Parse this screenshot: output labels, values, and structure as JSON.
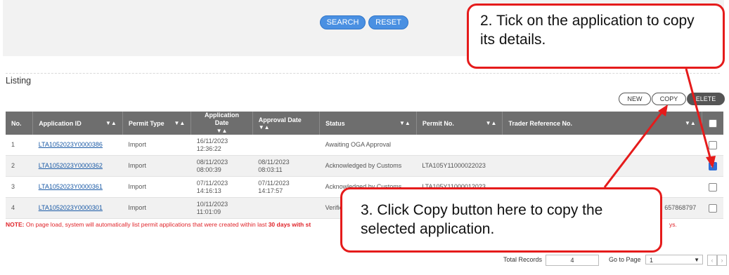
{
  "search_bar": {
    "search_label": "SEARCH",
    "reset_label": "RESET"
  },
  "listing": {
    "title": "Listing",
    "actions": {
      "new_label": "NEW",
      "copy_label": "COPY",
      "delete_label": "ELETE"
    }
  },
  "table": {
    "headers": [
      "No.",
      "Application ID",
      "Permit Type",
      "Application Date",
      "Approval Date",
      "Status",
      "Permit No.",
      "Trader Reference No."
    ],
    "sort_glyph": "▼▲",
    "rows": [
      {
        "no": "1",
        "app_id": "LTA1052023Y0000386",
        "permit_type": "Import",
        "app_date": "16/11/2023",
        "app_time": "12:36:22",
        "appr_date": "",
        "appr_time": "",
        "status": "Awaiting OGA Approval",
        "permit_no": "",
        "trader_ref": "",
        "checked": false
      },
      {
        "no": "2",
        "app_id": "LTA1052023Y0000362",
        "permit_type": "Import",
        "app_date": "08/11/2023",
        "app_time": "08:00:39",
        "appr_date": "08/11/2023",
        "appr_time": "08:03:11",
        "status": "Acknowledged by Customs",
        "permit_no": "LTA105Y11000022023",
        "trader_ref": "",
        "checked": true
      },
      {
        "no": "3",
        "app_id": "LTA1052023Y0000361",
        "permit_type": "Import",
        "app_date": "07/11/2023",
        "app_time": "14:16:13",
        "appr_date": "07/11/2023",
        "appr_time": "14:17:57",
        "status": "Acknowledged by Customs",
        "permit_no": "LTA105Y11000012023",
        "trader_ref": "",
        "checked": false
      },
      {
        "no": "4",
        "app_id": "LTA1052023Y0000301",
        "permit_type": "Import",
        "app_date": "10/11/2023",
        "app_time": "11:01:09",
        "appr_date": "",
        "appr_time": "",
        "status": "Verified",
        "permit_no": "",
        "trader_ref": "657868797",
        "checked": false
      }
    ]
  },
  "note": {
    "prefix": "NOTE:",
    "text": " On page load, system will automatically list permit applications that were created within last ",
    "bold": "30 days with st",
    "tail": "ys."
  },
  "footer": {
    "total_label": "Total Records",
    "total_value": "4",
    "goto_label": "Go to Page",
    "page_value": "1"
  },
  "callouts": {
    "tick": "2.  Tick on the application to copy its details.",
    "copy": "3.  Click Copy button here to copy the selected application."
  },
  "colors": {
    "accent": "#4a90e2",
    "callout_border": "#e51b1b",
    "header_bg": "#6e6e6e",
    "note_red": "#e0242a"
  }
}
